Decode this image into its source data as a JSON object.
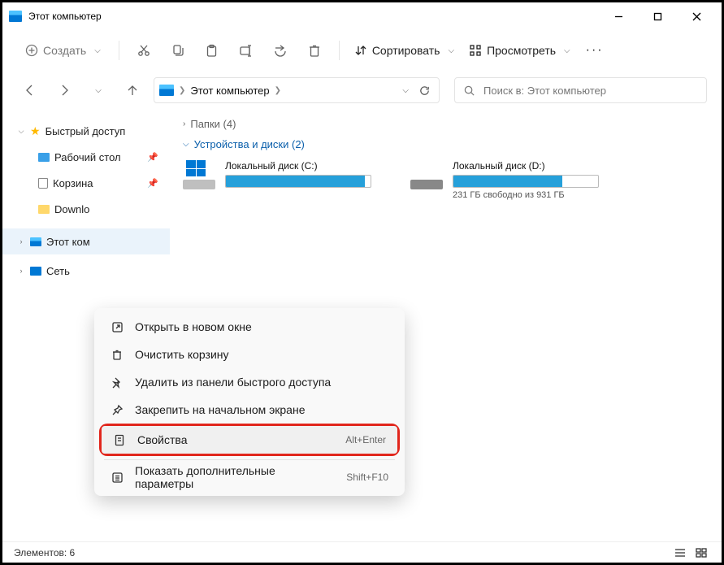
{
  "title": "Этот компьютер",
  "toolbar": {
    "create": "Создать",
    "sort": "Сортировать",
    "view": "Просмотреть"
  },
  "address": {
    "crumb": "Этот компьютер",
    "search_placeholder": "Поиск в: Этот компьютер"
  },
  "sidebar": {
    "quick": "Быстрый доступ",
    "desktop": "Рабочий стол",
    "recycle": "Корзина",
    "downloads": "Downlo",
    "thispc": "Этот ком",
    "network": "Сеть"
  },
  "main": {
    "folders_header": "Папки (4)",
    "drives_header": "Устройства и диски (2)",
    "drive_c": {
      "name": "Локальный диск (C:)",
      "free": "",
      "fill_pct": 96
    },
    "drive_d": {
      "name": "Локальный диск (D:)",
      "free": "231 ГБ свободно из 931 ГБ",
      "fill_pct": 75
    }
  },
  "ctx": {
    "open_new": "Открыть в новом окне",
    "empty_bin": "Очистить корзину",
    "unpin_quick": "Удалить из панели быстрого доступа",
    "pin_start": "Закрепить на начальном экране",
    "properties": "Свойства",
    "properties_key": "Alt+Enter",
    "more": "Показать дополнительные параметры",
    "more_key": "Shift+F10"
  },
  "status": {
    "items": "Элементов: 6"
  }
}
